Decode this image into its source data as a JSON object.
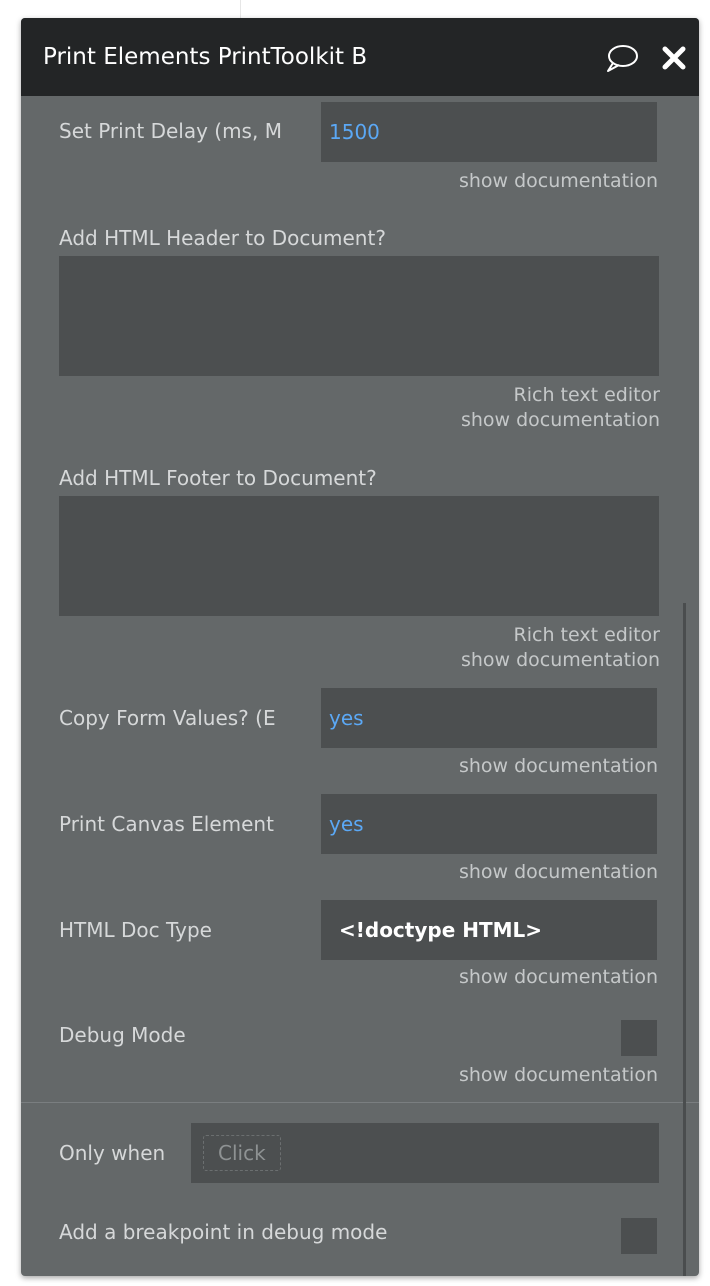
{
  "panel": {
    "title": "Print Elements PrintToolkit B",
    "comment_icon": "speech-bubble-icon",
    "close_icon": "close-icon"
  },
  "fields": {
    "print_delay": {
      "label": "Set Print Delay (ms, M",
      "value": "1500",
      "doc": "show documentation"
    },
    "header": {
      "label": "Add HTML Header to Document?",
      "value": "",
      "editor": "Rich text editor",
      "doc": "show documentation"
    },
    "footer": {
      "label": "Add HTML Footer to Document?",
      "value": "",
      "editor": "Rich text editor",
      "doc": "show documentation"
    },
    "copy_form": {
      "label": "Copy Form Values? (E",
      "value": "yes",
      "doc": "show documentation"
    },
    "print_canvas": {
      "label": "Print Canvas Element",
      "value": "yes",
      "doc": "show documentation"
    },
    "doc_type": {
      "label": "HTML Doc Type",
      "value": "<!doctype HTML>",
      "doc": "show documentation"
    },
    "debug_mode": {
      "label": "Debug Mode",
      "checked": false,
      "doc": "show documentation"
    }
  },
  "conditions": {
    "only_when_label": "Only when",
    "only_when_placeholder": "Click",
    "breakpoint_label": "Add a breakpoint in debug mode",
    "breakpoint_checked": false
  },
  "colors": {
    "header_bg": "#232526",
    "panel_bg": "#646869",
    "field_bg": "#4c4f50",
    "value_blue": "#5ba8f5"
  }
}
